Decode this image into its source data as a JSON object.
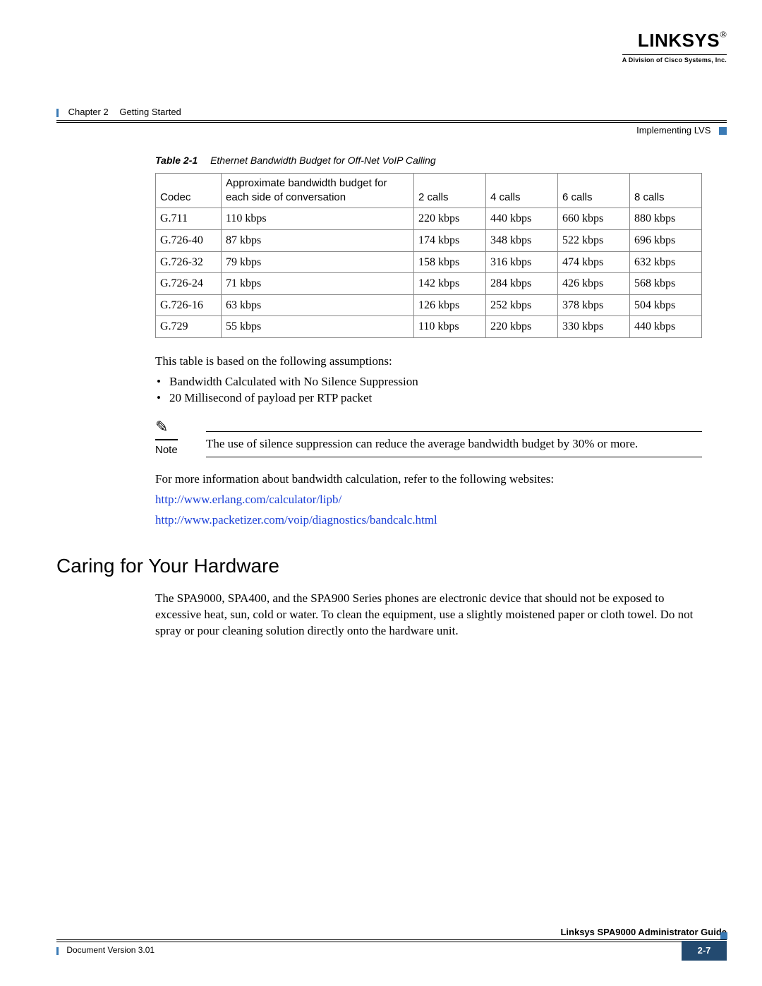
{
  "header": {
    "logo_word": "LINKSYS",
    "logo_reg": "®",
    "logo_sub": "A Division of Cisco Systems, Inc.",
    "chapter_num": "Chapter 2",
    "chapter_title": "Getting Started",
    "section_title": "Implementing LVS"
  },
  "table": {
    "caption_num": "Table 2-1",
    "caption_title": "Ethernet Bandwidth Budget for Off-Net VoIP Calling",
    "headers": {
      "codec": "Codec",
      "bw": "Approximate bandwidth budget for each side of conversation",
      "c2": "2 calls",
      "c4": "4 calls",
      "c6": "6 calls",
      "c8": "8 calls"
    },
    "rows": [
      {
        "codec": "G.711",
        "bw": "110 kbps",
        "c2": "220 kbps",
        "c4": "440 kbps",
        "c6": "660 kbps",
        "c8": "880 kbps"
      },
      {
        "codec": "G.726-40",
        "bw": "87 kbps",
        "c2": "174 kbps",
        "c4": "348 kbps",
        "c6": "522 kbps",
        "c8": "696 kbps"
      },
      {
        "codec": "G.726-32",
        "bw": "79 kbps",
        "c2": "158 kbps",
        "c4": "316 kbps",
        "c6": "474 kbps",
        "c8": "632 kbps"
      },
      {
        "codec": "G.726-24",
        "bw": "71 kbps",
        "c2": "142 kbps",
        "c4": "284 kbps",
        "c6": "426 kbps",
        "c8": "568 kbps"
      },
      {
        "codec": "G.726-16",
        "bw": "63 kbps",
        "c2": "126 kbps",
        "c4": "252 kbps",
        "c6": "378 kbps",
        "c8": "504 kbps"
      },
      {
        "codec": "G.729",
        "bw": "55 kbps",
        "c2": "110 kbps",
        "c4": "220 kbps",
        "c6": "330 kbps",
        "c8": "440 kbps"
      }
    ]
  },
  "body": {
    "intro": "This table is based on the following assumptions:",
    "bullet1": "Bandwidth Calculated with No Silence Suppression",
    "bullet2": "20 Millisecond of payload per RTP packet",
    "note_label": "Note",
    "note_text": "The use of silence suppression can reduce the average bandwidth budget by 30% or more.",
    "more_info": "For more information about bandwidth calculation, refer to the following websites:",
    "link1": "http://www.erlang.com/calculator/lipb/",
    "link2": "http://www.packetizer.com/voip/diagnostics/bandcalc.html"
  },
  "section2": {
    "head": "Caring for Your Hardware",
    "para": "The SPA9000, SPA400, and the SPA900 Series phones are electronic device that should not be exposed to excessive heat, sun, cold or water. To clean the equipment, use a slightly moistened paper or cloth towel. Do not spray or pour cleaning solution directly onto the hardware unit."
  },
  "footer": {
    "guide": "Linksys SPA9000 Administrator Guide",
    "version": "Document Version 3.01",
    "page": "2-7"
  }
}
